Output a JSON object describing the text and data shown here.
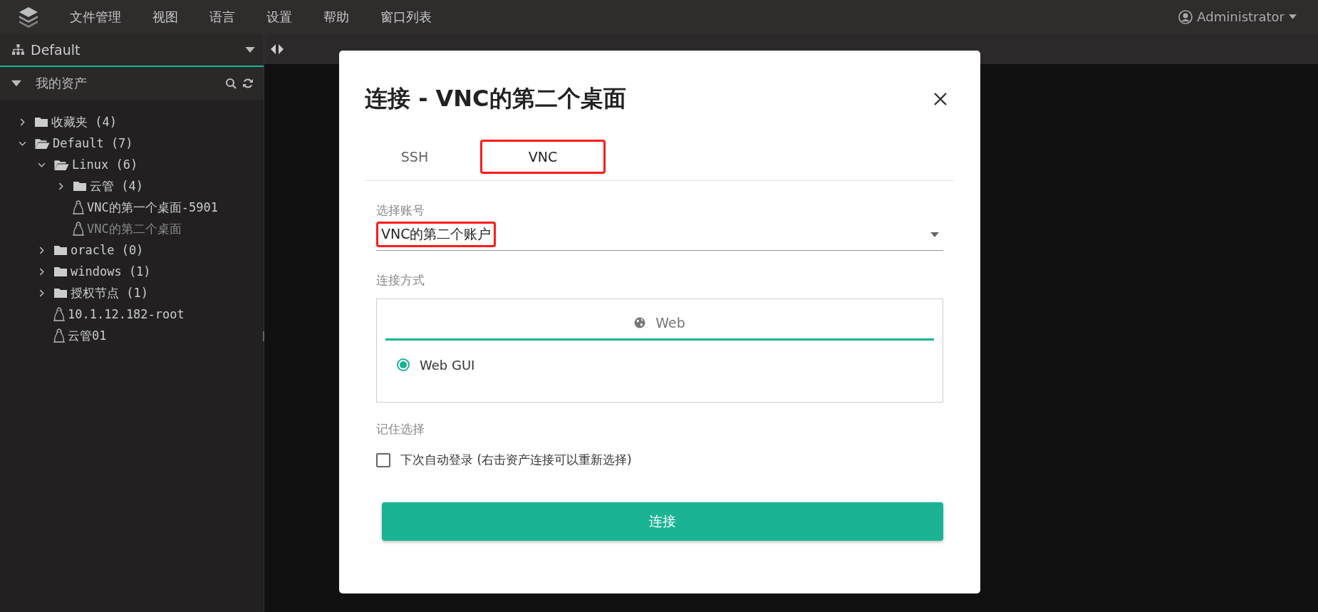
{
  "menubar": {
    "menus": [
      "文件管理",
      "视图",
      "语言",
      "设置",
      "帮助",
      "窗口列表"
    ],
    "user": "Administrator"
  },
  "sidebar": {
    "workspace": "Default",
    "section": {
      "title": "我的资产",
      "expanded": true
    },
    "tree": [
      {
        "label": "收藏夹 (4)",
        "kind": "folder",
        "expanded": false
      },
      {
        "label": "Default (7)",
        "kind": "folder",
        "expanded": true,
        "children": [
          {
            "label": "Linux (6)",
            "kind": "folder",
            "expanded": true,
            "children": [
              {
                "label": "云管 (4)",
                "kind": "folder",
                "expanded": false
              },
              {
                "label": "VNC的第一个桌面-5901",
                "kind": "host",
                "disabled": false
              },
              {
                "label": "VNC的第二个桌面",
                "kind": "host",
                "disabled": true
              }
            ]
          },
          {
            "label": "oracle (0)",
            "kind": "folder",
            "expanded": false
          },
          {
            "label": "windows (1)",
            "kind": "folder",
            "expanded": false
          },
          {
            "label": "授权节点 (1)",
            "kind": "folder",
            "expanded": false
          },
          {
            "label": "10.1.12.182-root",
            "kind": "host",
            "disabled": false
          },
          {
            "label": "云管01",
            "kind": "host",
            "disabled": false
          }
        ]
      }
    ]
  },
  "dialog": {
    "title": "连接 - VNC的第二个桌面",
    "tabs": [
      {
        "label": "SSH",
        "selected": false
      },
      {
        "label": "VNC",
        "selected": true
      }
    ],
    "account": {
      "label": "选择账号",
      "value": "VNC的第二个账户"
    },
    "method": {
      "label": "连接方式",
      "tab": "Web",
      "options": [
        {
          "label": "Web GUI",
          "selected": true
        }
      ]
    },
    "remember": {
      "label": "记住选择",
      "checkbox_label": "下次自动登录 (右击资产连接可以重新选择)",
      "checked": false
    },
    "submit": "连接"
  }
}
